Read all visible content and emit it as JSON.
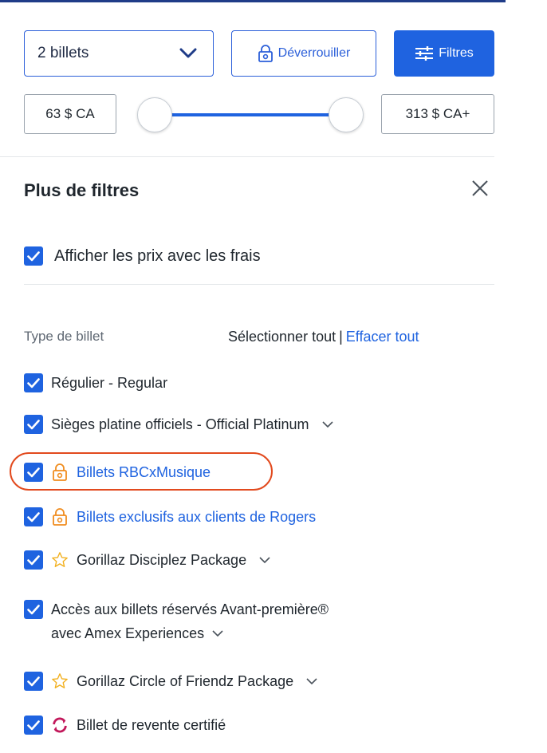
{
  "controls": {
    "ticket_quantity": "2 billets",
    "unlock_label": "Déverrouiller",
    "filters_label": "Filtres",
    "price_min": "63 $ CA",
    "price_max": "313 $ CA+"
  },
  "panel": {
    "title": "Plus de filtres",
    "show_fees_label": "Afficher les prix avec les frais",
    "show_fees_checked": true,
    "section_label": "Type de billet",
    "select_all": "Sélectionner tout",
    "separator": "|",
    "clear_all": "Effacer tout"
  },
  "ticket_types": [
    {
      "label": "Régulier - Regular",
      "checked": true,
      "icon": ""
    },
    {
      "label": "Sièges platine officiels - Official Platinum",
      "checked": true,
      "icon": "",
      "expandable": true
    },
    {
      "label": "Billets RBCxMusique",
      "checked": true,
      "icon": "lock-icon",
      "link": true,
      "highlighted": true
    },
    {
      "label": "Billets exclusifs aux clients de Rogers",
      "checked": true,
      "icon": "lock-icon",
      "link": true
    },
    {
      "label": "Gorillaz Disciplez Package",
      "checked": true,
      "icon": "star-icon",
      "expandable": true
    },
    {
      "label_line1": "Accès aux billets réservés Avant-première®",
      "label_line2": "avec Amex Experiences",
      "checked": true,
      "icon": "",
      "expandable": true
    },
    {
      "label": "Gorillaz Circle of Friendz Package",
      "checked": true,
      "icon": "star-icon",
      "expandable": true
    },
    {
      "label": "Billet de revente certifié",
      "checked": true,
      "icon": "resale-icon"
    }
  ],
  "colors": {
    "primary": "#1f63e0",
    "lock_orange": "#f08c1e",
    "star_yellow": "#f2b01e",
    "resale_magenta": "#c2185b",
    "highlight_red": "#e24a1e"
  }
}
